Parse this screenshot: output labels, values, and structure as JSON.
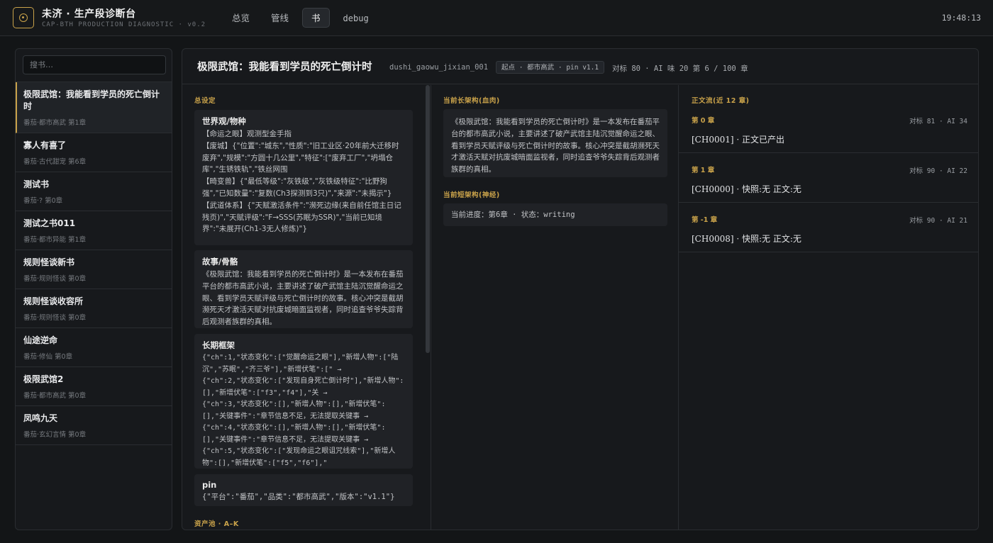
{
  "app": {
    "title": "未济 · 生产段诊断台",
    "subtitle": "CAP-BTH PRODUCTION DIAGNOSTIC · v0.2",
    "clock": "19:48:13",
    "accent_color": "#c9a24a",
    "logo_icon": "target-ring-icon"
  },
  "nav": {
    "tabs": [
      {
        "label": "总览",
        "active": false
      },
      {
        "label": "管线",
        "active": false
      },
      {
        "label": "书",
        "active": true
      },
      {
        "label": "debug",
        "active": false
      }
    ]
  },
  "sidebar": {
    "search_placeholder": "搜书…",
    "books": [
      {
        "name": "极限武馆：我能看到学员的死亡倒计时",
        "meta": "番茄·都市高武  第1章",
        "active": true
      },
      {
        "name": "寡人有喜了",
        "meta": "番茄·古代甜宠  第6章",
        "active": false
      },
      {
        "name": "测试书",
        "meta": "番茄·?  第0章",
        "active": false
      },
      {
        "name": "测试之书011",
        "meta": "番茄·都市异能  第1章",
        "active": false
      },
      {
        "name": "规则怪谈新书",
        "meta": "番茄·规则怪谈  第0章",
        "active": false
      },
      {
        "name": "规则怪谈收容所",
        "meta": "番茄·规则怪谈  第0章",
        "active": false
      },
      {
        "name": "仙途逆命",
        "meta": "番茄·修仙  第0章",
        "active": false
      },
      {
        "name": "极限武馆2",
        "meta": "番茄·都市高武  第0章",
        "active": false
      },
      {
        "name": "凤鸣九天",
        "meta": "番茄·玄幻言情  第0章",
        "active": false
      }
    ]
  },
  "book": {
    "title": "极限武馆：我能看到学员的死亡倒计时",
    "id": "dushi_gaowu_jixian_001",
    "tag": "起点 · 都市高武 · pin v1.1",
    "stats": "对标 80 · AI 味 20   第 6 / 100 章"
  },
  "settings": {
    "label": "总设定",
    "cards": [
      {
        "title": "世界观/物种",
        "body": "【命运之眼】观测型金手指\n【废城】{\"位置\":\"城东\",\"性质\":\"旧工业区·20年前大迁移时废弃\",\"规模\":\"方圆十几公里\",\"特征\":[\"废弃工厂\",\"坍塌仓库\",\"生锈铁轨\",\"铁丝网围\n【畸变兽】{\"最低等级\":\"灰铁级\",\"灰铁级特征\":\"比野狗强\",\"已知数量\":\"复数(Ch3探测到3只)\",\"来源\":\"未揭示\"}\n【武道体系】{\"天赋激活条件\":\"濒死边缘(来自前任馆主日记残页)\",\"天赋评级\":\"F→SSS(苏眠为SSR)\",\"当前已知境界\":\"未展开(Ch1-3无人修炼)\"}",
        "mono": false
      },
      {
        "title": "故事/骨骼",
        "body": "《极限武馆：我能看到学员的死亡倒计时》是一本发布在番茄平台的都市高武小说，主要讲述了破产武馆主陆沉觉醒命运之眼、看到学员天赋评级与死亡倒计时的故事。核心冲突是截胡濒死天才激活天赋对抗废城暗面监视者，同时追查爷爷失踪背后观测者族群的真相。",
        "mono": false
      },
      {
        "title": "长期框架",
        "body": "{\"ch\":1,\"状态变化\":[\"觉醒命运之眼\"],\"新增人物\":[\"陆沉\",\"苏眠\",\"齐三爷\"],\"新增伏笔\":[\" →\n{\"ch\":2,\"状态变化\":[\"发现自身死亡倒计时\"],\"新增人物\":[],\"新增伏笔\":[\"f3\",\"f4\"],\"关 →\n{\"ch\":3,\"状态变化\":[],\"新增人物\":[],\"新增伏笔\":[],\"关键事件\":\"章节信息不足，无法提取关键事 →\n{\"ch\":4,\"状态变化\":[],\"新增人物\":[],\"新增伏笔\":[],\"关键事件\":\"章节信息不足，无法提取关键事 →\n{\"ch\":5,\"状态变化\":[\"发现命运之眼诅咒线索\"],\"新增人物\":[],\"新增伏笔\":[\"f5\",\"f6\"],\"",
        "mono": true
      },
      {
        "title": "pin",
        "body": "{\"平台\":\"番茄\",\"品类\":\"都市高武\",\"版本\":\"v1.1\"}",
        "mono": true
      }
    ],
    "asset_pool_label": "资产池 · A–K"
  },
  "long_arch": {
    "label": "当前长架构(血肉)",
    "body": "《极限武馆：我能看到学员的死亡倒计时》是一本发布在番茄平台的都市高武小说，主要讲述了破产武馆主陆沉觉醒命运之眼、看到学员天赋评级与死亡倒计时的故事。核心冲突是截胡濒死天才激活天赋对抗废城暗面监视者，同时追查爷爷失踪背后观测者族群的真相。"
  },
  "short_arch": {
    "label": "当前短架构(神经)",
    "body": "当前进度：第6章 · 状态：writing"
  },
  "text_stream": {
    "label": "正文流(近 12 章)",
    "chapters": [
      {
        "label": "第 0 章",
        "score": "对标 81 · AI 34",
        "text": "[CH0001] · 正文已产出"
      },
      {
        "label": "第 1 章",
        "score": "对标 90 · AI 22",
        "text": "[CH0000] · 快照:无 正文:无"
      },
      {
        "label": "第 -1 章",
        "score": "对标 90 · AI 21",
        "text": "[CH0008] · 快照:无 正文:无"
      }
    ]
  }
}
